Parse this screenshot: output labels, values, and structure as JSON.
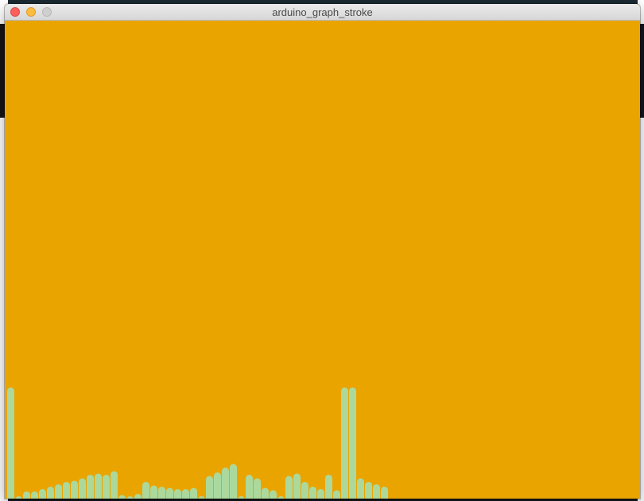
{
  "window": {
    "title": "arduino_graph_stroke"
  },
  "colors": {
    "canvas_background": "#eaa400",
    "stroke": "#acd99b"
  },
  "chart_data": {
    "type": "bar",
    "values": [
      93,
      2,
      6,
      6,
      8,
      10,
      12,
      14,
      15,
      17,
      20,
      21,
      20,
      23,
      3,
      2,
      4,
      14,
      11,
      10,
      9,
      8,
      8,
      9,
      2,
      19,
      22,
      26,
      29,
      2,
      20,
      17,
      9,
      7,
      2,
      19,
      21,
      14,
      10,
      8,
      20,
      7,
      93,
      93,
      17,
      14,
      12,
      10
    ],
    "ylim": [
      0,
      400
    ]
  }
}
